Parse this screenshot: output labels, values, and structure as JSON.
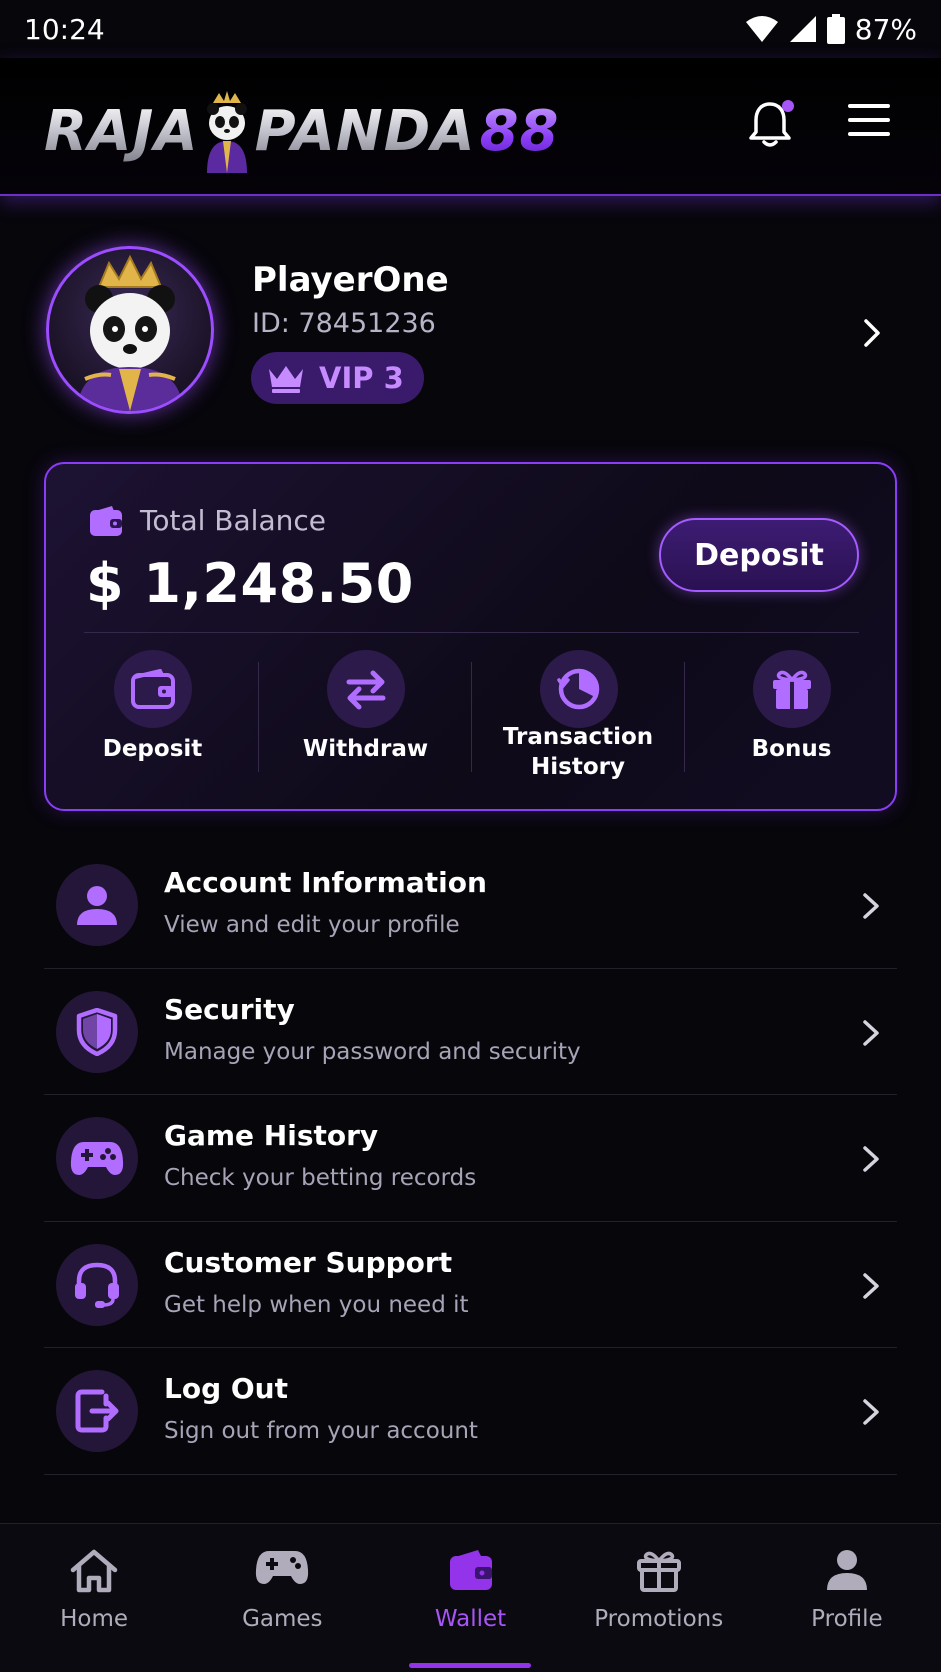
{
  "status_bar": {
    "time": "10:24",
    "battery": "87%"
  },
  "header": {
    "logo_left": "RAJA",
    "logo_middle": "PANDA",
    "logo_accent": "88",
    "notification_dot": true,
    "accent_color": "#a855f7"
  },
  "profile": {
    "username": "PlayerOne",
    "id_text": "ID: 78451236",
    "vip_label": "VIP 3"
  },
  "balance": {
    "label": "Total Balance",
    "amount": "$ 1,248.50",
    "deposit_button": "Deposit",
    "actions": [
      {
        "label": "Deposit",
        "icon": "wallet-icon"
      },
      {
        "label": "Withdraw",
        "icon": "swap-arrows-icon"
      },
      {
        "label": "Transaction History",
        "icon": "history-clock-icon"
      },
      {
        "label": "Bonus",
        "icon": "gift-icon"
      }
    ]
  },
  "menu": [
    {
      "title": "Account Information",
      "subtitle": "View and edit your profile",
      "icon": "user-icon"
    },
    {
      "title": "Security",
      "subtitle": "Manage your password and security",
      "icon": "shield-icon"
    },
    {
      "title": "Game History",
      "subtitle": "Check your betting records",
      "icon": "gamepad-icon"
    },
    {
      "title": "Customer Support",
      "subtitle": "Get help when you need it",
      "icon": "headset-icon"
    },
    {
      "title": "Log Out",
      "subtitle": "Sign out from your account",
      "icon": "logout-icon"
    }
  ],
  "bottom_nav": [
    {
      "label": "Home",
      "icon": "home-icon",
      "active": false
    },
    {
      "label": "Games",
      "icon": "gamepad-icon",
      "active": false
    },
    {
      "label": "Wallet",
      "icon": "wallet-icon",
      "active": true
    },
    {
      "label": "Promotions",
      "icon": "gift-icon",
      "active": false
    },
    {
      "label": "Profile",
      "icon": "user-icon",
      "active": false
    }
  ]
}
